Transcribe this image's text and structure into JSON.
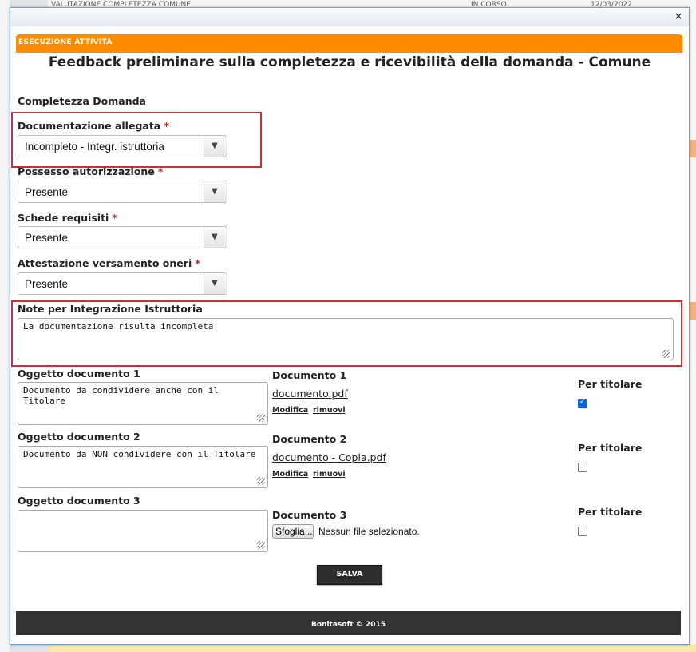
{
  "background": {
    "row_text": "VALUTAZIONE COMPLETEZZA COMUNE",
    "row_status": "IN CORSO",
    "row_date": "12/03/2022"
  },
  "dialog": {
    "close_icon": "×",
    "taskbar_title": "ESECUZIONE ATTIVITÀ",
    "heading": "Feedback preliminare sulla completezza e ricevibilità della domanda - Comune",
    "section_title": "Completezza Domanda",
    "required_mark": "*",
    "fields": {
      "documentazione": {
        "label": "Documentazione allegata",
        "value": "Incompleto - Integr. istruttoria"
      },
      "possesso": {
        "label": "Possesso autorizzazione",
        "value": "Presente"
      },
      "schede": {
        "label": "Schede requisiti",
        "value": "Presente"
      },
      "attestazione": {
        "label": "Attestazione versamento oneri",
        "value": "Presente"
      }
    },
    "dropdown_arrow": "▼",
    "note": {
      "label": "Note per Integrazione Istruttoria",
      "value": "La documentazione risulta incompleta"
    },
    "documents": [
      {
        "oggetto_label": "Oggetto documento 1",
        "oggetto_value": "Documento da condividere anche con il Titolare",
        "doc_label": "Documento 1",
        "file": "documento.pdf",
        "modifica": "Modifica",
        "rimuovi": "rimuovi",
        "titolare_label": "Per titolare",
        "titolare_checked": true
      },
      {
        "oggetto_label": "Oggetto documento 2",
        "oggetto_value": "Documento da NON condividere con il Titolare",
        "doc_label": "Documento 2",
        "file": "documento - Copia.pdf",
        "modifica": "Modifica",
        "rimuovi": "rimuovi",
        "titolare_label": "Per titolare",
        "titolare_checked": false
      },
      {
        "oggetto_label": "Oggetto documento 3",
        "oggetto_value": "",
        "doc_label": "Documento 3",
        "file_button": "Sfoglia...",
        "file_status": "Nessun file selezionato.",
        "titolare_label": "Per titolare",
        "titolare_checked": false
      }
    ],
    "save_label": "SALVA",
    "footer": "Bonitasoft © 2015"
  },
  "colors": {
    "accent": "#ff8c00",
    "highlight_border": "#c9303a",
    "footer_bg": "#333333"
  }
}
